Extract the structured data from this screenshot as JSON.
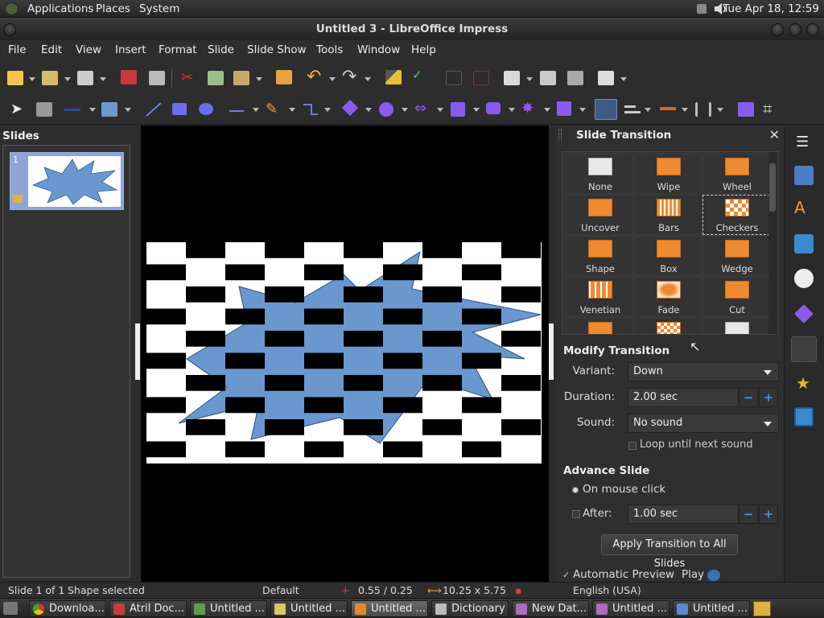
{
  "top_panel": {
    "menus": [
      "Applications",
      "Places",
      "System"
    ],
    "clock": "Tue Apr 18, 12:59"
  },
  "window": {
    "title": "Untitled 3 - LibreOffice Impress"
  },
  "menubar": [
    "File",
    "Edit",
    "View",
    "Insert",
    "Format",
    "Slide",
    "Slide Show",
    "Tools",
    "Window",
    "Help"
  ],
  "slides_panel": {
    "title": "Slides",
    "thumb_number": "1"
  },
  "transition_panel": {
    "title": "Slide Transition",
    "close": "✕",
    "transitions": [
      {
        "label": "None",
        "selected": false
      },
      {
        "label": "Wipe",
        "selected": false
      },
      {
        "label": "Wheel",
        "selected": false
      },
      {
        "label": "Uncover",
        "selected": false
      },
      {
        "label": "Bars",
        "selected": false
      },
      {
        "label": "Checkers",
        "selected": true
      },
      {
        "label": "Shape",
        "selected": false
      },
      {
        "label": "Box",
        "selected": false
      },
      {
        "label": "Wedge",
        "selected": false
      },
      {
        "label": "Venetian",
        "selected": false
      },
      {
        "label": "Fade",
        "selected": false
      },
      {
        "label": "Cut",
        "selected": false
      }
    ],
    "modify": {
      "heading": "Modify Transition",
      "variant_label": "Variant:",
      "variant_value": "Down",
      "duration_label": "Duration:",
      "duration_value": "2.00 sec",
      "sound_label": "Sound:",
      "sound_value": "No sound",
      "loop_label": "Loop until next sound"
    },
    "advance": {
      "heading": "Advance Slide",
      "on_click_label": "On mouse click",
      "after_label": "After:",
      "after_value": "1.00 sec"
    },
    "apply_all": "Apply Transition to All Slides",
    "auto_preview": "Automatic Preview",
    "play": "Play",
    "spin_minus": "−",
    "spin_plus": "+"
  },
  "statusbar": {
    "slide": "Slide 1 of 1",
    "selection": "Shape selected",
    "layout": "Default",
    "position": "0.55 / 0.25",
    "size": "10.25 x 5.75",
    "language": "English (USA)"
  },
  "taskbar": [
    {
      "label": "Downloa...",
      "active": false
    },
    {
      "label": "Atril Doc...",
      "active": false
    },
    {
      "label": "Untitled ...",
      "active": false
    },
    {
      "label": "Untitled ...",
      "active": false
    },
    {
      "label": "Untitled ...",
      "active": true
    },
    {
      "label": "Dictionary",
      "active": false
    },
    {
      "label": "New Dat...",
      "active": false
    },
    {
      "label": "Untitled ...",
      "active": false
    },
    {
      "label": "Untitled ...",
      "active": false
    }
  ],
  "colors": {
    "accent_blue": "#4d8fe0",
    "transition_icon": "#f08a2e",
    "star_fill": "#6b97cf",
    "thumb_highlight": "#8fa4d6"
  }
}
